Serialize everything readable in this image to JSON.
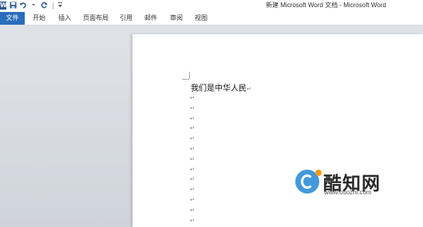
{
  "titlebar": {
    "title": "新建 Microsoft Word 文档 - Microsoft Word",
    "word_logo": "W"
  },
  "tabs": {
    "file": "文件",
    "home": "开始",
    "insert": "插入",
    "page_layout": "页面布局",
    "references": "引用",
    "mailings": "邮件",
    "review": "审阅",
    "view": "视图"
  },
  "document": {
    "first_line": "我们是中华人民",
    "paragraph_mark": "↵"
  },
  "watermark": {
    "name": "酷知网",
    "url": "www.coozhi.com"
  },
  "colors": {
    "accent": "#2b6dbd",
    "logo_orange": "#f39c12",
    "logo_blue": "#2f8fd8"
  }
}
